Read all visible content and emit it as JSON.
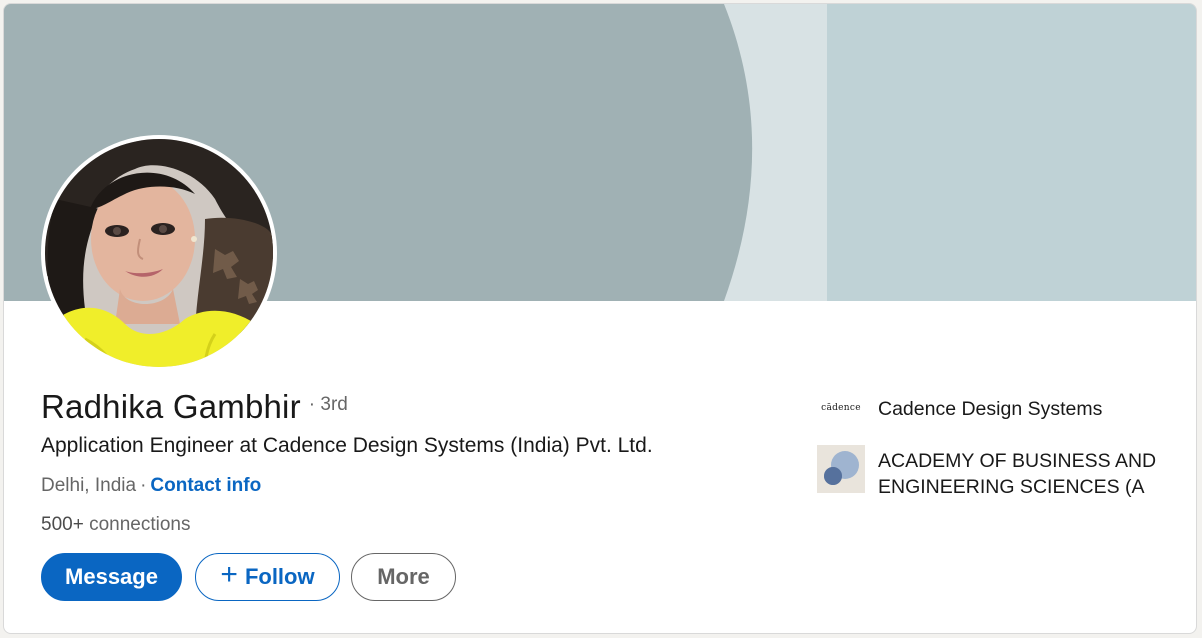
{
  "colors": {
    "banner_dark": "#a0b1b4",
    "banner_light": "#bfd2d6",
    "banner_strip": "#d8e2e4",
    "primary_blue": "#0a66c2",
    "text_primary": "#191919",
    "text_secondary": "#666666"
  },
  "profile": {
    "name": "Radhika Gambhir",
    "degree": "· 3rd",
    "headline": "Application Engineer at Cadence Design Systems (India) Pvt. Ltd.",
    "location": "Delhi, India",
    "location_separator": "·",
    "contact_info_label": "Contact info",
    "connections_count": "500+",
    "connections_label": "connections"
  },
  "actions": {
    "message_label": "Message",
    "follow_icon": "plus-icon",
    "follow_label": "Follow",
    "more_label": "More"
  },
  "organizations": [
    {
      "logo_text": "cādence",
      "name": "Cadence Design Systems"
    },
    {
      "logo_icon": "academy-logo-icon",
      "name": "ACADEMY OF BUSINESS AND ENGINEERING SCIENCES (A"
    }
  ]
}
